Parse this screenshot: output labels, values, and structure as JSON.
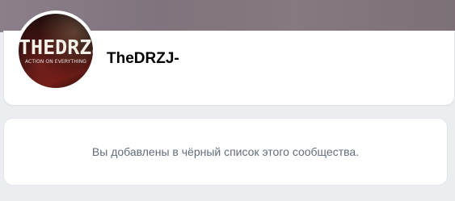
{
  "community": {
    "name": "TheDRZJ-",
    "avatar": {
      "logo_text": "THEDRZJ",
      "tagline": "ACTION ON EVERYTHING"
    }
  },
  "message": {
    "text": "Вы добавлены в чёрный список этого сообщества."
  },
  "colors": {
    "page_background": "#ebedf0",
    "card_background": "#ffffff",
    "message_text": "#626d7a"
  }
}
